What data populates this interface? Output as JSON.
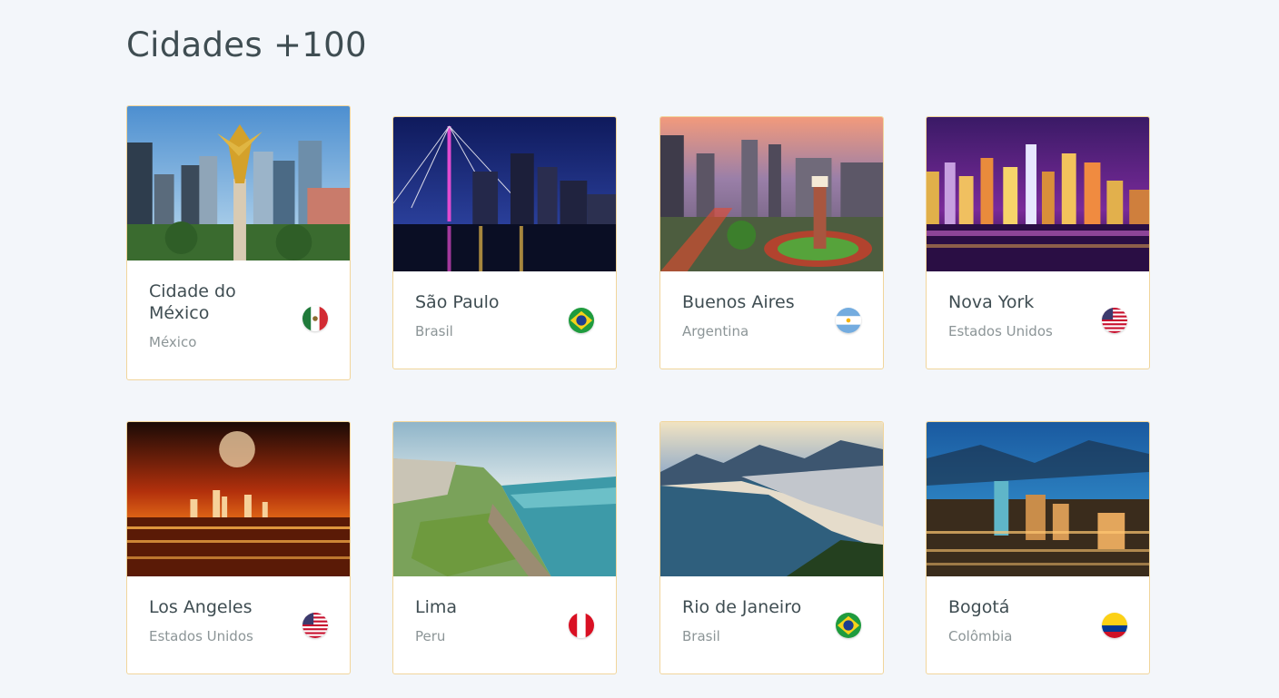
{
  "page": {
    "title": "Cidades +100"
  },
  "cities": [
    {
      "name": "Cidade do México",
      "country": "México",
      "flag": "mexico-flag-icon",
      "image": "mexico-city-angel-monument-photo"
    },
    {
      "name": "São Paulo",
      "country": "Brasil",
      "flag": "brazil-flag-icon",
      "image": "sao-paulo-bridge-night-photo"
    },
    {
      "name": "Buenos Aires",
      "country": "Argentina",
      "flag": "argentina-flag-icon",
      "image": "buenos-aires-city-dusk-photo"
    },
    {
      "name": "Nova York",
      "country": "Estados Unidos",
      "flag": "usa-flag-icon",
      "image": "new-york-skyline-night-photo"
    },
    {
      "name": "Los Angeles",
      "country": "Estados Unidos",
      "flag": "usa-flag-icon",
      "image": "los-angeles-night-moon-photo"
    },
    {
      "name": "Lima",
      "country": "Peru",
      "flag": "peru-flag-icon",
      "image": "lima-coast-cliffs-photo"
    },
    {
      "name": "Rio de Janeiro",
      "country": "Brasil",
      "flag": "brazil-flag-icon",
      "image": "rio-de-janeiro-beach-photo"
    },
    {
      "name": "Bogotá",
      "country": "Colômbia",
      "flag": "colombia-flag-icon",
      "image": "bogota-city-dusk-photo"
    }
  ],
  "colors": {
    "background": "#f3f6fa",
    "card_border": "#f1d59b",
    "heading": "#3f4d52",
    "subtext": "#8c9597"
  }
}
